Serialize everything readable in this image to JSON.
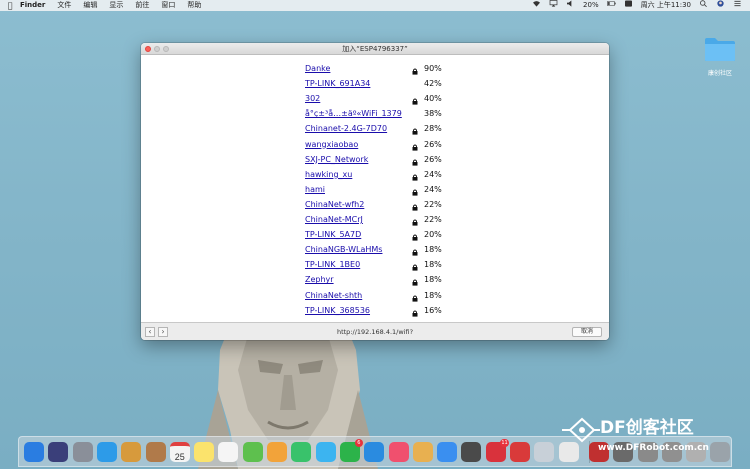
{
  "menubar": {
    "app": "Finder",
    "items": [
      "文件",
      "编辑",
      "显示",
      "前往",
      "窗口",
      "帮助"
    ],
    "battery": "20%",
    "clock": "周六 上午11:30"
  },
  "desktop": {
    "folder_label": "康创社区"
  },
  "window": {
    "title": "加入“ESP4796337”",
    "url": "http://192.168.4.1/wifi?",
    "cancel_label": "取消",
    "back_glyph": "‹",
    "forward_glyph": "›"
  },
  "networks": [
    {
      "ssid": "Danke",
      "locked": true,
      "signal": "90%"
    },
    {
      "ssid": "TP-LINK_691A34",
      "locked": false,
      "signal": "42%"
    },
    {
      "ssid": "302",
      "locked": true,
      "signal": "40%"
    },
    {
      "ssid": "å°ç±³å…±äº«WiFi_1379",
      "locked": false,
      "signal": "38%"
    },
    {
      "ssid": "Chinanet-2.4G-7D70",
      "locked": true,
      "signal": "28%"
    },
    {
      "ssid": "wangxiaobao",
      "locked": true,
      "signal": "26%"
    },
    {
      "ssid": "SXJ-PC_Network",
      "locked": true,
      "signal": "26%"
    },
    {
      "ssid": "hawking_xu",
      "locked": true,
      "signal": "24%"
    },
    {
      "ssid": "hami",
      "locked": true,
      "signal": "24%"
    },
    {
      "ssid": "ChinaNet-wfh2",
      "locked": true,
      "signal": "22%"
    },
    {
      "ssid": "ChinaNet-MCrJ",
      "locked": true,
      "signal": "22%"
    },
    {
      "ssid": "TP-LINK_5A7D",
      "locked": true,
      "signal": "20%"
    },
    {
      "ssid": "ChinaNGB-WLaHMs",
      "locked": true,
      "signal": "18%"
    },
    {
      "ssid": "TP-LINK_1BE0",
      "locked": true,
      "signal": "18%"
    },
    {
      "ssid": "Zephyr",
      "locked": true,
      "signal": "18%"
    },
    {
      "ssid": "ChinaNet-shth",
      "locked": true,
      "signal": "18%"
    },
    {
      "ssid": "TP-LINK_368536",
      "locked": true,
      "signal": "16%"
    }
  ],
  "dock": {
    "calendar_day": "25",
    "badges": [
      "6",
      "11"
    ],
    "colors": [
      "#2a7de1",
      "#3a3f7a",
      "#8a8f99",
      "#2d9be8",
      "#d79a3c",
      "#b07a4a",
      "#f4f4f4",
      "#fbe36c",
      "#f5f5f5",
      "#5ec04e",
      "#f2a33a",
      "#39c26b",
      "#3cb4f0",
      "#2cb34a",
      "#2a8be0",
      "#f0506e",
      "#e8b050",
      "#3a8ff0",
      "#4a4a4a",
      "#d9323c",
      "#d93a3a",
      "#c8d0d8",
      "#e9e9e9",
      "#c03030",
      "#6a6a6a",
      "#8a8a8a",
      "#909090",
      "#b0b0b0",
      "#9aa3aa"
    ]
  },
  "watermark": {
    "brand": "DF创客社区",
    "url": "www.DFRobot.com.cn"
  }
}
